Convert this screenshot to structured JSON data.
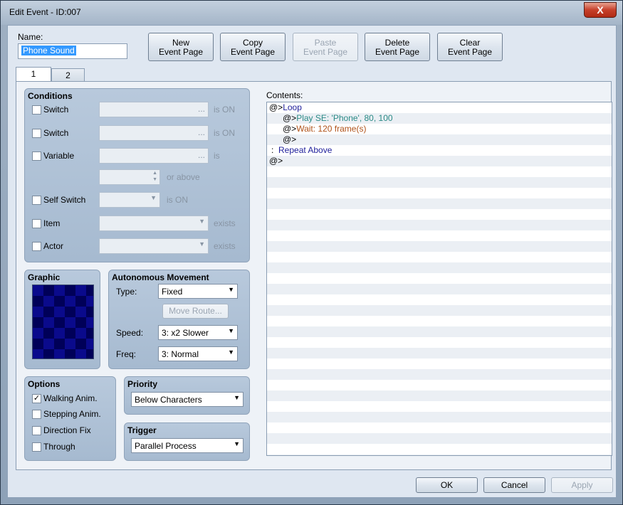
{
  "window": {
    "title": "Edit Event - ID:007",
    "close_label": "X"
  },
  "name": {
    "label": "Name:",
    "value": "Phone Sound"
  },
  "toolbar": {
    "new_label": [
      "New",
      "Event Page"
    ],
    "copy_label": [
      "Copy",
      "Event Page"
    ],
    "paste_label": [
      "Paste",
      "Event Page"
    ],
    "delete_label": [
      "Delete",
      "Event Page"
    ],
    "clear_label": [
      "Clear",
      "Event Page"
    ]
  },
  "tabs": [
    {
      "label": "1",
      "active": true
    },
    {
      "label": "2",
      "active": false
    }
  ],
  "conditions": {
    "title": "Conditions",
    "switch1": {
      "label": "Switch",
      "value": "...",
      "suffix": "is ON",
      "checked": false
    },
    "switch2": {
      "label": "Switch",
      "value": "...",
      "suffix": "is ON",
      "checked": false
    },
    "variable": {
      "label": "Variable",
      "value": "...",
      "suffix": "is",
      "or_above": "or above",
      "checked": false
    },
    "self_switch": {
      "label": "Self Switch",
      "suffix": "is ON",
      "checked": false
    },
    "item": {
      "label": "Item",
      "suffix": "exists",
      "checked": false
    },
    "actor": {
      "label": "Actor",
      "suffix": "exists",
      "checked": false
    }
  },
  "graphic": {
    "title": "Graphic"
  },
  "autonomous": {
    "title": "Autonomous Movement",
    "type_label": "Type:",
    "type_value": "Fixed",
    "move_route_label": "Move Route...",
    "speed_label": "Speed:",
    "speed_value": "3: x2 Slower",
    "freq_label": "Freq:",
    "freq_value": "3: Normal"
  },
  "options": {
    "title": "Options",
    "walking": {
      "label": "Walking Anim.",
      "checked": true,
      "mark": "✓"
    },
    "stepping": {
      "label": "Stepping Anim.",
      "checked": false
    },
    "direction_fix": {
      "label": "Direction Fix",
      "checked": false
    },
    "through": {
      "label": "Through",
      "checked": false
    }
  },
  "priority": {
    "title": "Priority",
    "value": "Below Characters"
  },
  "trigger": {
    "title": "Trigger",
    "value": "Parallel Process"
  },
  "contents": {
    "label": "Contents:",
    "lines": [
      {
        "prefix": "@>",
        "text": "Loop"
      },
      {
        "prefix": "@>",
        "text": "Play SE: 'Phone', 80, 100"
      },
      {
        "prefix": "@>",
        "text": "Wait: 120 frame(s)"
      },
      {
        "prefix": "@>",
        "text": ""
      },
      {
        "prefix": ":",
        "text": "Repeat Above"
      },
      {
        "prefix": "@>",
        "text": ""
      }
    ]
  },
  "footer": {
    "ok_label": "OK",
    "cancel_label": "Cancel",
    "apply_label": "Apply"
  },
  "colors": {
    "loop": "#1e1e9a",
    "se": "#2b8a86",
    "wait": "#b0531a",
    "selection": "#3399ff"
  },
  "icons": {
    "close": "close-icon",
    "dropdown": "chevron-down-icon",
    "spinner": "spinner-arrows-icon"
  }
}
